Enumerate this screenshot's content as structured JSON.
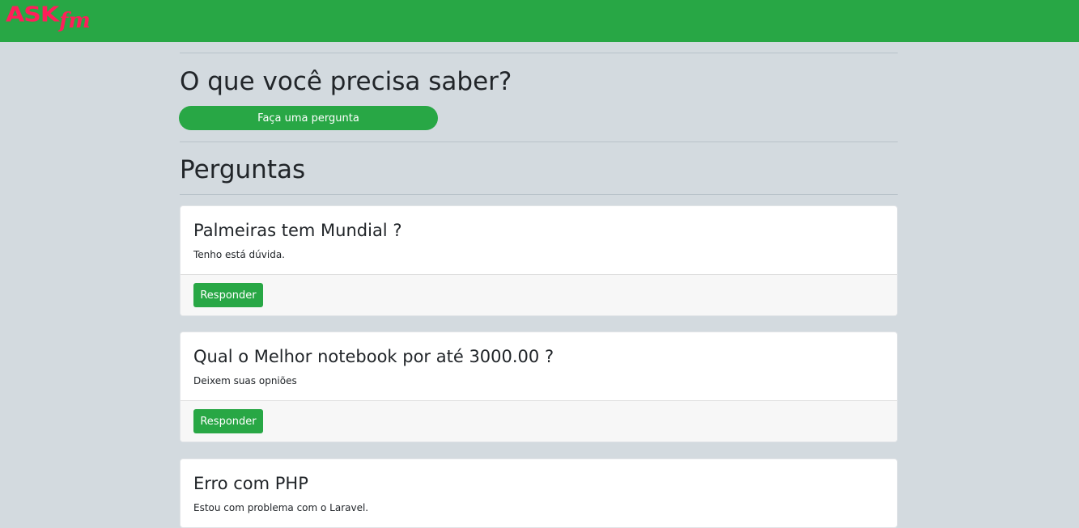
{
  "brand": {
    "logo_ask": "ASK",
    "logo_fm": "fm"
  },
  "ask_section": {
    "title": "O que você precisa saber?",
    "button_label": "Faça uma pergunta"
  },
  "questions_section": {
    "title": "Perguntas",
    "reply_label": "Responder",
    "items": [
      {
        "title": "Palmeiras tem Mundial ?",
        "text": "Tenho está dúvida."
      },
      {
        "title": "Qual o Melhor notebook por até 3000.00 ?",
        "text": "Deixem suas opniões"
      },
      {
        "title": "Erro com PHP",
        "text": "Estou com problema com o Laravel."
      }
    ]
  },
  "colors": {
    "primary_green": "#28a745",
    "logo_pink": "#ff1f5a",
    "page_background": "#d3dadf"
  }
}
